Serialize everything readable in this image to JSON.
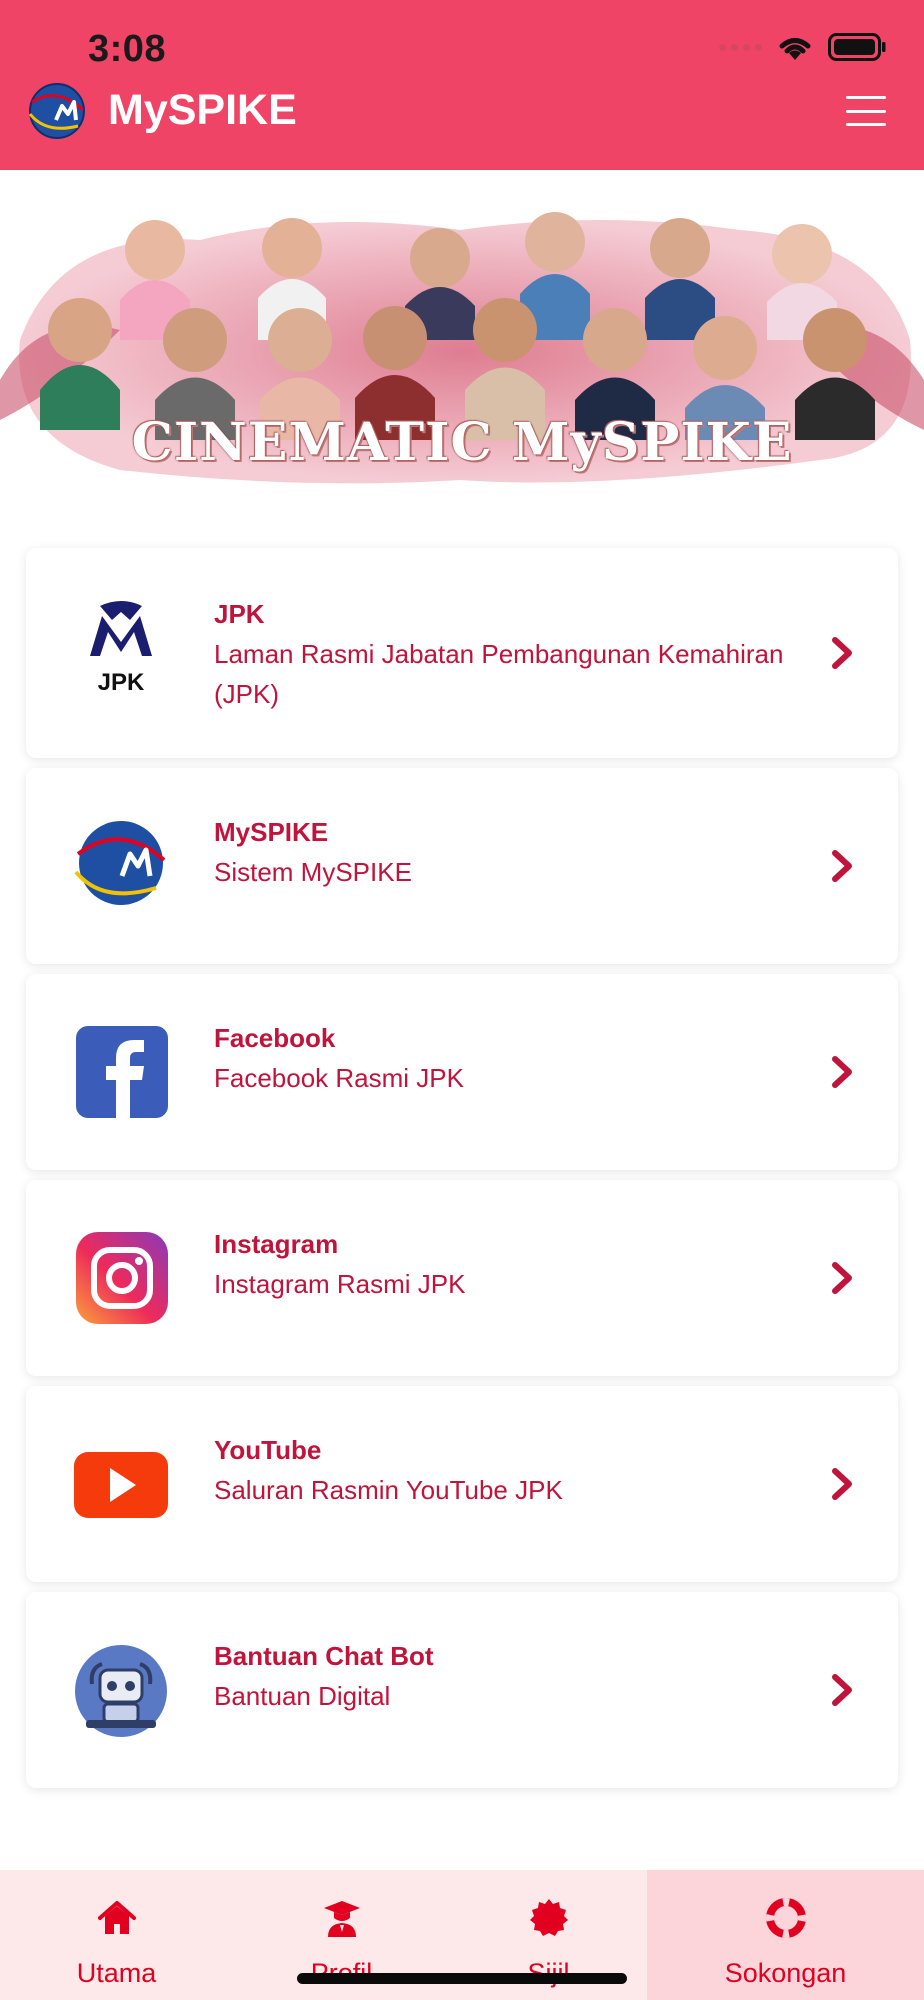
{
  "status_bar": {
    "time": "3:08"
  },
  "header": {
    "title": "MySPIKE",
    "bg_color": "#f04466"
  },
  "banner": {
    "caption": "CINEMATIC MySPIKE"
  },
  "links": [
    {
      "title": "JPK",
      "subtitle": "Laman Rasmi Jabatan Pembangunan Kemahiran (JPK)",
      "icon": "jpk-logo-icon",
      "logo_text": "JPK"
    },
    {
      "title": "MySPIKE",
      "subtitle": "Sistem MySPIKE",
      "icon": "myspike-logo-icon"
    },
    {
      "title": "Facebook",
      "subtitle": "Facebook Rasmi JPK",
      "icon": "facebook-icon"
    },
    {
      "title": "Instagram",
      "subtitle": "Instagram Rasmi JPK",
      "icon": "instagram-icon"
    },
    {
      "title": "YouTube",
      "subtitle": "Saluran Rasmin YouTube JPK",
      "icon": "youtube-icon"
    },
    {
      "title": "Bantuan Chat Bot",
      "subtitle": "Bantuan Digital",
      "icon": "chatbot-icon"
    }
  ],
  "tabbar": {
    "items": [
      {
        "label": "Utama",
        "icon": "home-icon"
      },
      {
        "label": "Profil",
        "icon": "graduate-icon"
      },
      {
        "label": "Sijil",
        "icon": "certificate-icon"
      },
      {
        "label": "Sokongan",
        "icon": "lifebuoy-icon",
        "active": true
      }
    ],
    "accent_color": "#e1001f"
  }
}
